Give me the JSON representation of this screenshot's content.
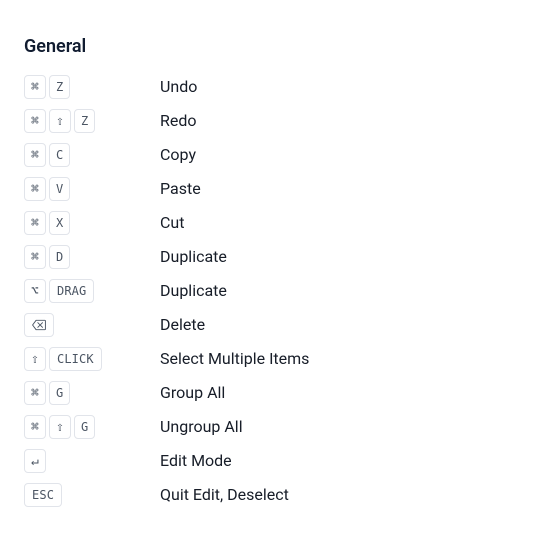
{
  "section": {
    "title": "General"
  },
  "glyphs": {
    "cmd": "⌘",
    "shift": "⇧",
    "option": "⌥",
    "enter": "↵"
  },
  "shortcuts": [
    {
      "keys": [
        {
          "t": "glyph",
          "v": "cmd"
        },
        {
          "t": "text",
          "v": "Z"
        }
      ],
      "action": "Undo"
    },
    {
      "keys": [
        {
          "t": "glyph",
          "v": "cmd"
        },
        {
          "t": "glyph",
          "v": "shift"
        },
        {
          "t": "text",
          "v": "Z"
        }
      ],
      "action": "Redo"
    },
    {
      "keys": [
        {
          "t": "glyph",
          "v": "cmd"
        },
        {
          "t": "text",
          "v": "C"
        }
      ],
      "action": "Copy"
    },
    {
      "keys": [
        {
          "t": "glyph",
          "v": "cmd"
        },
        {
          "t": "text",
          "v": "V"
        }
      ],
      "action": "Paste"
    },
    {
      "keys": [
        {
          "t": "glyph",
          "v": "cmd"
        },
        {
          "t": "text",
          "v": "X"
        }
      ],
      "action": "Cut"
    },
    {
      "keys": [
        {
          "t": "glyph",
          "v": "cmd"
        },
        {
          "t": "text",
          "v": "D"
        }
      ],
      "action": "Duplicate"
    },
    {
      "keys": [
        {
          "t": "glyph",
          "v": "option"
        },
        {
          "t": "text",
          "v": "DRAG"
        }
      ],
      "action": "Duplicate"
    },
    {
      "keys": [
        {
          "t": "icon",
          "v": "backspace"
        }
      ],
      "action": "Delete"
    },
    {
      "keys": [
        {
          "t": "glyph",
          "v": "shift"
        },
        {
          "t": "text",
          "v": "CLICK"
        }
      ],
      "action": "Select Multiple Items"
    },
    {
      "keys": [
        {
          "t": "glyph",
          "v": "cmd"
        },
        {
          "t": "text",
          "v": "G"
        }
      ],
      "action": "Group All"
    },
    {
      "keys": [
        {
          "t": "glyph",
          "v": "cmd"
        },
        {
          "t": "glyph",
          "v": "shift"
        },
        {
          "t": "text",
          "v": "G"
        }
      ],
      "action": "Ungroup All"
    },
    {
      "keys": [
        {
          "t": "glyph",
          "v": "enter"
        }
      ],
      "action": "Edit Mode"
    },
    {
      "keys": [
        {
          "t": "text",
          "v": "ESC"
        }
      ],
      "action": "Quit Edit, Deselect"
    }
  ]
}
